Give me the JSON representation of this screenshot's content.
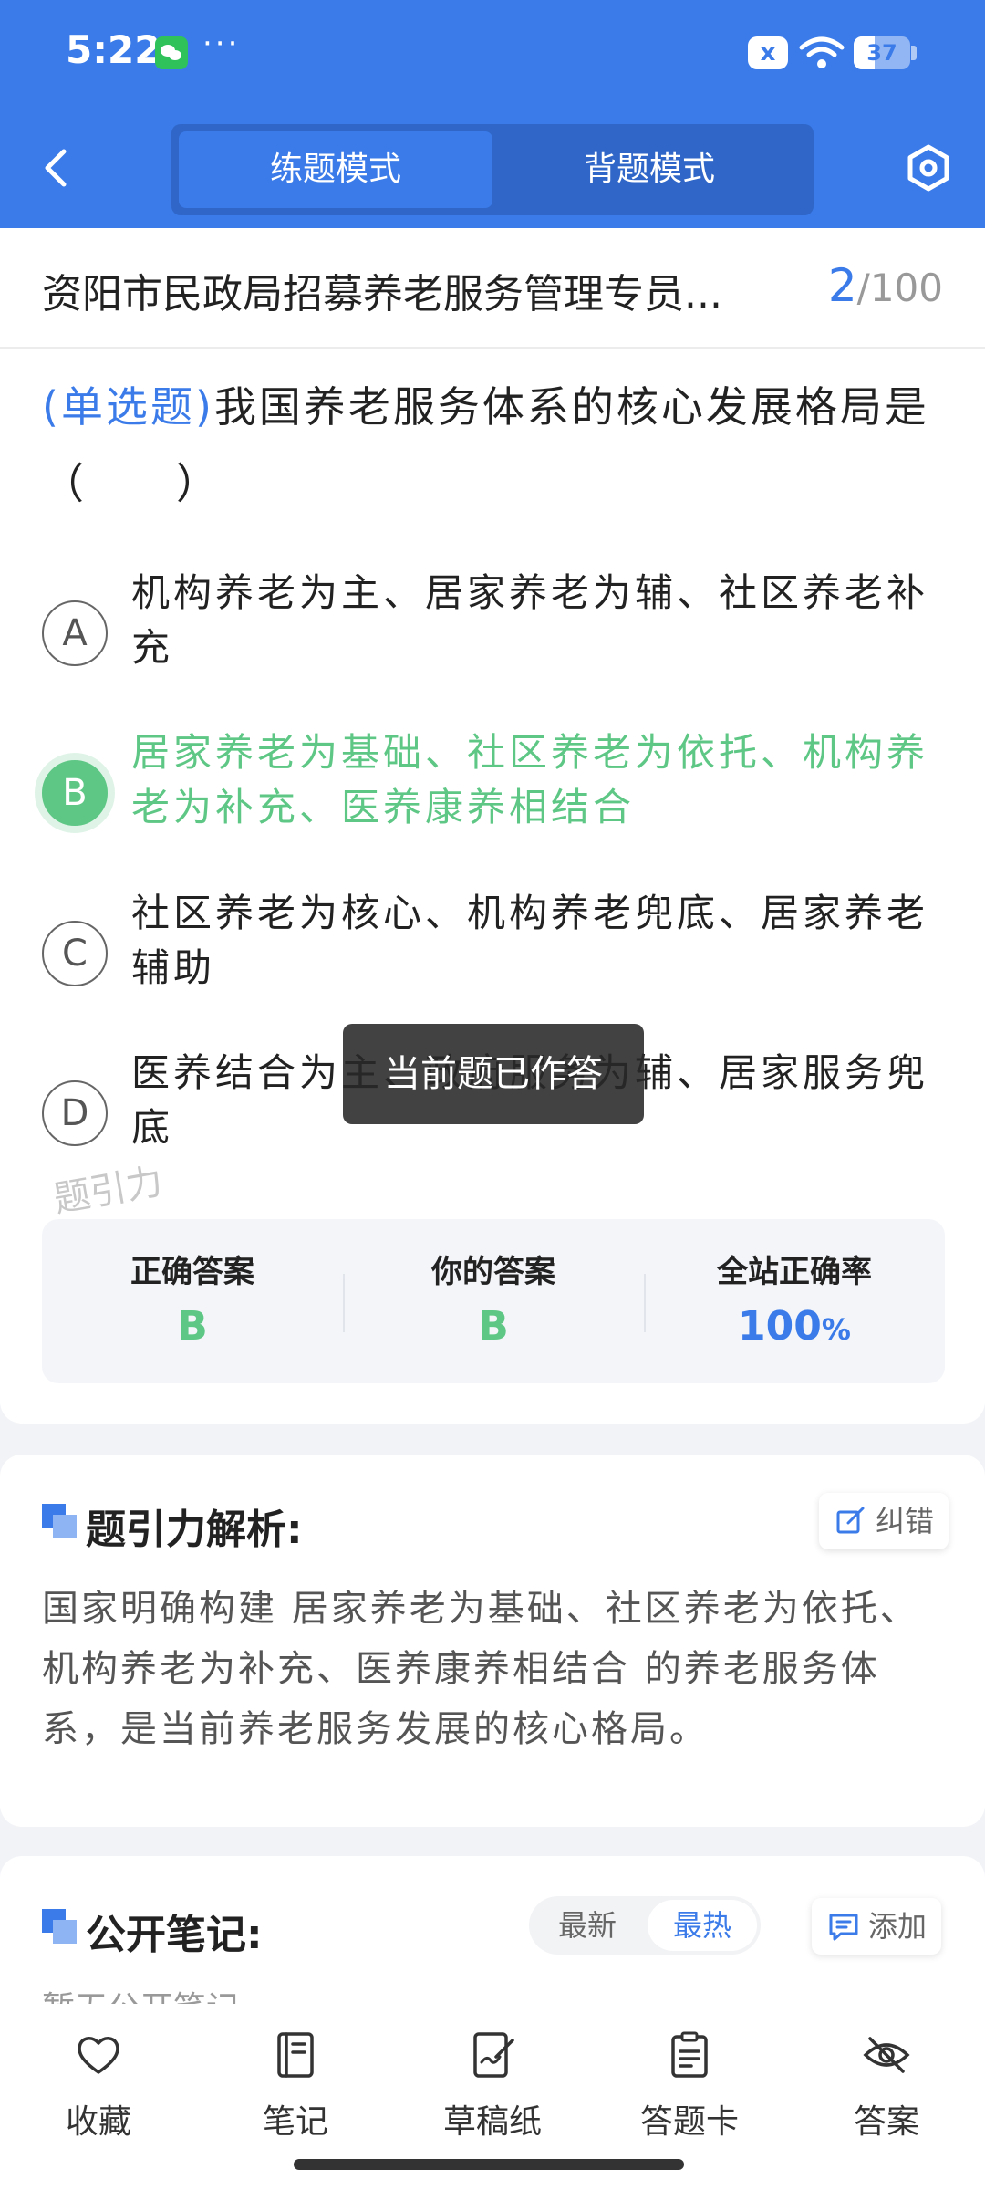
{
  "status_bar": {
    "time": "5:22",
    "dots": "···",
    "mute_icon": "x",
    "battery": "37",
    "battery_level": 0.37
  },
  "header": {
    "mode_practice": "练题模式",
    "mode_recite": "背题模式"
  },
  "paper": {
    "title": "资阳市民政局招募养老服务管理专员...",
    "current": "2",
    "separator": "/",
    "total": "100"
  },
  "question": {
    "type": "(单选题)",
    "text": "我国养老服务体系的核心发展格局是（　　）"
  },
  "options": [
    {
      "letter": "A",
      "text": "机构养老为主、居家养老为辅、社区养老补充"
    },
    {
      "letter": "B",
      "text": "居家养老为基础、社区养老为依托、机构养老为补充、医养康养相结合"
    },
    {
      "letter": "C",
      "text": "社区养老为核心、机构养老兜底、居家养老辅助"
    },
    {
      "letter": "D",
      "text": "医养结合为主、政府服务为辅、居家服务兜底"
    }
  ],
  "toast": "当前题已作答",
  "watermark": "题引力",
  "answer_summary": {
    "correct_label": "正确答案",
    "correct_value": "B",
    "yours_label": "你的答案",
    "yours_value": "B",
    "rate_label": "全站正确率",
    "rate_value": "100",
    "rate_unit": "%"
  },
  "analysis": {
    "title": "题引力解析:",
    "correct_button": "纠错",
    "text": "国家明确构建 居家养老为基础、社区养老为依托、机构养老为补充、医养康养相结合 的养老服务体系，是当前养老服务发展的核心格局。"
  },
  "notes": {
    "title": "公开笔记:",
    "sort_latest": "最新",
    "sort_hot": "最热",
    "add_button": "添加",
    "empty_text": "暂无公开笔记"
  },
  "bottom_nav": [
    {
      "label": "收藏",
      "icon": "heart-icon"
    },
    {
      "label": "笔记",
      "icon": "notebook-icon"
    },
    {
      "label": "草稿纸",
      "icon": "draft-paper-icon"
    },
    {
      "label": "答题卡",
      "icon": "answer-card-icon"
    },
    {
      "label": "答案",
      "icon": "eye-off-icon"
    }
  ],
  "colors": {
    "primary": "#3a7be9",
    "correct": "#5ec785"
  }
}
